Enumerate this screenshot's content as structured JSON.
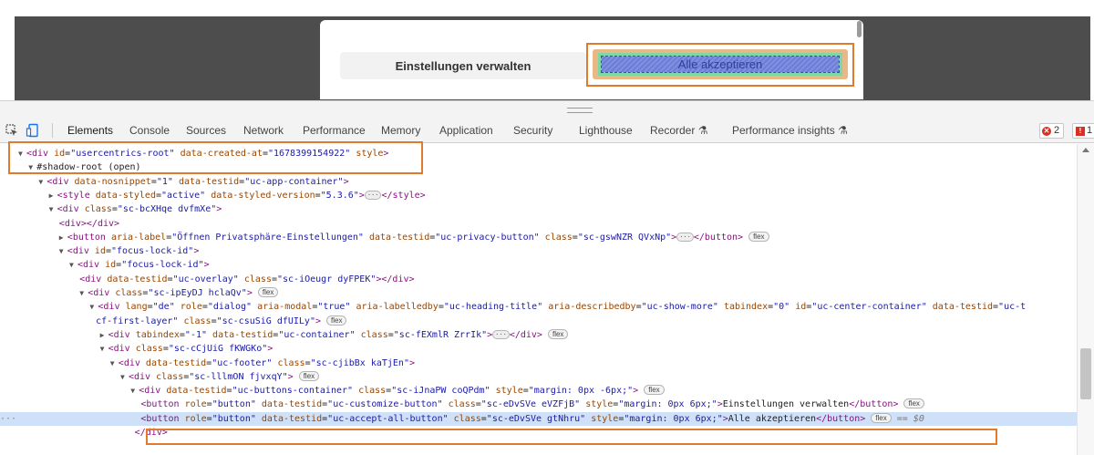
{
  "page": {
    "customize_label": "Einstellungen verwalten",
    "accept_label": "Alle akzeptieren"
  },
  "toolbar": {
    "tabs": [
      "Elements",
      "Console",
      "Sources",
      "Network",
      "Performance",
      "Memory",
      "Application",
      "Security",
      "Lighthouse",
      "Recorder",
      "Performance insights"
    ],
    "active_tab": "Elements",
    "error_count": "2",
    "issue_count": "1"
  },
  "tree": {
    "lines": [
      {
        "indent": 1,
        "arrow": "▼",
        "html": "<span class=\"tag\">&lt;div</span> <span class=\"an\">id</span>=<span class=\"av\">\"usercentrics-root\"</span> <span class=\"an\">data-created-at</span>=<span class=\"av\">\"1678399154922\"</span> <span class=\"an\">style</span><span class=\"tag\">&gt;</span>"
      },
      {
        "indent": 2,
        "arrow": "▼",
        "html": "<span class=\"txt\">#shadow-root (open)</span>"
      },
      {
        "indent": 3,
        "arrow": "▼",
        "html": "<span class=\"tag\">&lt;div</span> <span class=\"an\">data-nosnippet</span>=<span class=\"av\">\"1\"</span> <span class=\"an\">data-testid</span>=<span class=\"av\">\"uc-app-container\"</span><span class=\"tag\">&gt;</span>"
      },
      {
        "indent": 4,
        "arrow": "▶",
        "html": "<span class=\"tag\">&lt;style</span> <span class=\"an\">data-styled</span>=<span class=\"av\">\"active\"</span> <span class=\"an\">data-styled-version</span>=<span class=\"av\">\"5.3.6\"</span><span class=\"tag\">&gt;</span><span class=\"ellip\">···</span><span class=\"tag\">&lt;/style&gt;</span>"
      },
      {
        "indent": 4,
        "arrow": "▼",
        "html": "<span class=\"tag\">&lt;div</span> <span class=\"an\">class</span>=<span class=\"av\">\"sc-bcXHqe dvfmXe\"</span><span class=\"tag\">&gt;</span>"
      },
      {
        "indent": 5,
        "arrow": "",
        "html": "<span class=\"tag\">&lt;div&gt;&lt;/div&gt;</span>"
      },
      {
        "indent": 5,
        "arrow": "▶",
        "html": "<span class=\"tag\">&lt;button</span> <span class=\"an\">aria-label</span>=<span class=\"av\">\"Öffnen Privatsphäre-Einstellungen\"</span> <span class=\"an\">data-testid</span>=<span class=\"av\">\"uc-privacy-button\"</span> <span class=\"an\">class</span>=<span class=\"av\">\"sc-gswNZR QVxNp\"</span><span class=\"tag\">&gt;</span><span class=\"ellip\">···</span><span class=\"tag\">&lt;/button&gt;</span> <span class=\"pill\">flex</span>"
      },
      {
        "indent": 5,
        "arrow": "▼",
        "html": "<span class=\"tag\">&lt;div</span> <span class=\"an\">id</span>=<span class=\"av\">\"focus-lock-id\"</span><span class=\"tag\">&gt;</span>"
      },
      {
        "indent": 6,
        "arrow": "▼",
        "html": "<span class=\"tag\">&lt;div</span> <span class=\"an\">id</span>=<span class=\"av\">\"focus-lock-id\"</span><span class=\"tag\">&gt;</span>"
      },
      {
        "indent": 7,
        "arrow": "",
        "html": "<span class=\"tag\">&lt;div</span> <span class=\"an\">data-testid</span>=<span class=\"av\">\"uc-overlay\"</span> <span class=\"an\">class</span>=<span class=\"av\">\"sc-iOeugr dyFPEK\"</span><span class=\"tag\">&gt;&lt;/div&gt;</span>"
      },
      {
        "indent": 7,
        "arrow": "▼",
        "html": "<span class=\"tag\">&lt;div</span> <span class=\"an\">class</span>=<span class=\"av\">\"sc-ipEyDJ hclaQv\"</span><span class=\"tag\">&gt;</span> <span class=\"pill\">flex</span>"
      },
      {
        "indent": 8,
        "arrow": "▼",
        "html": "<span class=\"tag\">&lt;div</span> <span class=\"an\">lang</span>=<span class=\"av\">\"de\"</span> <span class=\"an\">role</span>=<span class=\"av\">\"dialog\"</span> <span class=\"an\">aria-modal</span>=<span class=\"av\">\"true\"</span> <span class=\"an\">aria-labelledby</span>=<span class=\"av\">\"uc-heading-title\"</span> <span class=\"an\">aria-describedby</span>=<span class=\"av\">\"uc-show-more\"</span> <span class=\"an\">tabindex</span>=<span class=\"av\">\"0\"</span> <span class=\"an\">id</span>=<span class=\"av\">\"uc-center-container\"</span> <span class=\"an\">data-testid</span>=<span class=\"av\">\"uc-t</span>"
      },
      {
        "indent": 8.6,
        "arrow": "",
        "html": "<span class=\"av\">cf-first-layer\"</span> <span class=\"an\">class</span>=<span class=\"av\">\"sc-csuSiG dfUILy\"</span><span class=\"tag\">&gt;</span> <span class=\"pill\">flex</span>"
      },
      {
        "indent": 9,
        "arrow": "▶",
        "html": "<span class=\"tag\">&lt;div</span> <span class=\"an\">tabindex</span>=<span class=\"av\">\"-1\"</span> <span class=\"an\">data-testid</span>=<span class=\"av\">\"uc-container\"</span> <span class=\"an\">class</span>=<span class=\"av\">\"sc-fEXmlR ZrrIk\"</span><span class=\"tag\">&gt;</span><span class=\"ellip\">···</span><span class=\"tag\">&lt;/div&gt;</span> <span class=\"pill\">flex</span>"
      },
      {
        "indent": 9,
        "arrow": "▼",
        "html": "<span class=\"tag\">&lt;div</span> <span class=\"an\">class</span>=<span class=\"av\">\"sc-cCjUiG fKWGKo\"</span><span class=\"tag\">&gt;</span>"
      },
      {
        "indent": 10,
        "arrow": "▼",
        "html": "<span class=\"tag\">&lt;div</span> <span class=\"an\">data-testid</span>=<span class=\"av\">\"uc-footer\"</span> <span class=\"an\">class</span>=<span class=\"av\">\"sc-cjibBx kaTjEn\"</span><span class=\"tag\">&gt;</span>"
      },
      {
        "indent": 11,
        "arrow": "▼",
        "html": "<span class=\"tag\">&lt;div</span> <span class=\"an\">class</span>=<span class=\"av\">\"sc-lllmON fjvxqY\"</span><span class=\"tag\">&gt;</span> <span class=\"pill\">flex</span>"
      },
      {
        "indent": 12,
        "arrow": "▼",
        "html": "<span class=\"tag\">&lt;div</span> <span class=\"an\">data-testid</span>=<span class=\"av\">\"uc-buttons-container\"</span> <span class=\"an\">class</span>=<span class=\"av\">\"sc-iJnaPW coQPdm\"</span> <span class=\"an\">style</span>=<span class=\"av\">\"margin: 0px -6px;\"</span><span class=\"tag\">&gt;</span> <span class=\"pill\">flex</span>"
      },
      {
        "indent": 13,
        "arrow": "",
        "html": "<span class=\"tag\">&lt;button</span> <span class=\"an\">role</span>=<span class=\"av\">\"button\"</span> <span class=\"an\">data-testid</span>=<span class=\"av\">\"uc-customize-button\"</span> <span class=\"an\">class</span>=<span class=\"av\">\"sc-eDvSVe eVZFjB\"</span> <span class=\"an\">style</span>=<span class=\"av\">\"margin: 0px 6px;\"</span><span class=\"tag\">&gt;</span><span class=\"txt\">Einstellungen verwalten</span><span class=\"tag\">&lt;/button&gt;</span> <span class=\"pill\">flex</span>"
      },
      {
        "indent": 13,
        "arrow": "",
        "selected": true,
        "html": "<span class=\"tag\">&lt;button</span> <span class=\"an\">role</span>=<span class=\"av\">\"button\"</span> <span class=\"an\">data-testid</span>=<span class=\"av\">\"uc-accept-all-button\"</span> <span class=\"an\">class</span>=<span class=\"av\">\"sc-eDvSVe gtNhru\"</span> <span class=\"an\">style</span>=<span class=\"av\">\"margin: 0px 6px;\"</span><span class=\"tag\">&gt;</span><span class=\"txt\">Alle akzeptieren</span><span class=\"tag\">&lt;/button&gt;</span> <span class=\"pill\">flex</span> <span class=\"eq0\">== $0</span>"
      },
      {
        "indent": 12.4,
        "arrow": "",
        "html": "<span class=\"tag\">&lt;/div&gt;</span>"
      }
    ]
  }
}
